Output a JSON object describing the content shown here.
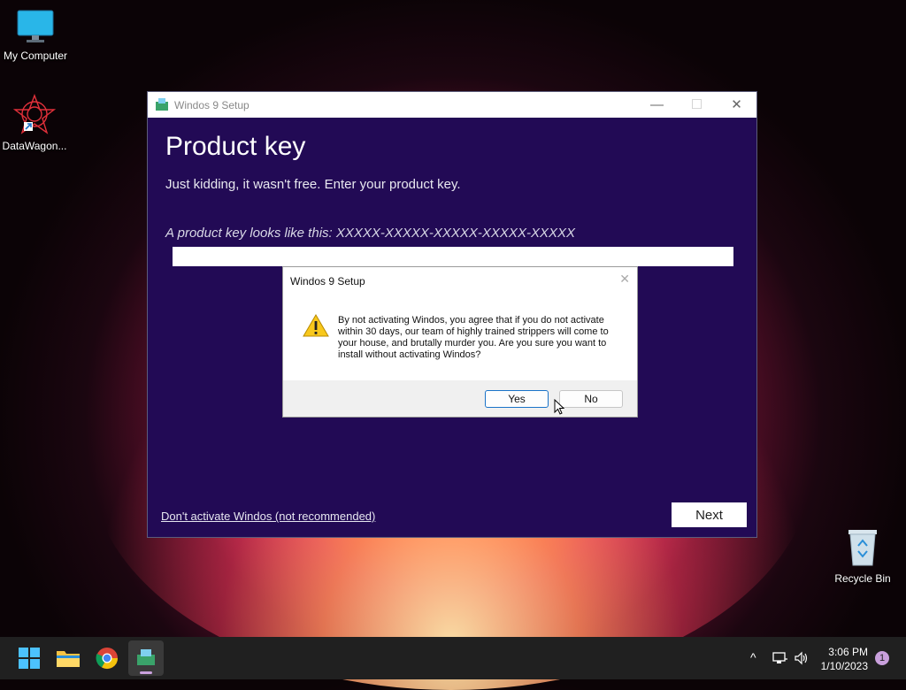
{
  "desktop": {
    "icons": [
      {
        "label": "My Computer"
      },
      {
        "label": "DataWagon..."
      },
      {
        "label": "Recycle Bin"
      }
    ]
  },
  "setup_window": {
    "title": "Windos 9 Setup",
    "heading": "Product key",
    "subtitle": "Just kidding, it wasn't free. Enter your product key.",
    "hint": "A product key looks like this: XXXXX-XXXXX-XXXXX-XXXXX-XXXXX",
    "key_value": "",
    "skip_link": "Don't activate Windos (not recommended)",
    "next_label": "Next",
    "minimize": "—",
    "maximize": "☐",
    "close": "✕"
  },
  "dialog": {
    "title": "Windos 9 Setup",
    "close": "✕",
    "message": "By not activating Windos, you agree that if you do not activate within 30 days, our team of highly trained strippers will come to your house, and brutally murder you. Are you sure you want to install without activating Windos?",
    "yes_label": "Yes",
    "no_label": "No"
  },
  "taskbar": {
    "time": "3:06 PM",
    "date": "1/10/2023",
    "notification_count": "1",
    "tray_chevron": "^"
  },
  "colors": {
    "window_bg": "#220a55",
    "accent": "#1a73c8"
  }
}
